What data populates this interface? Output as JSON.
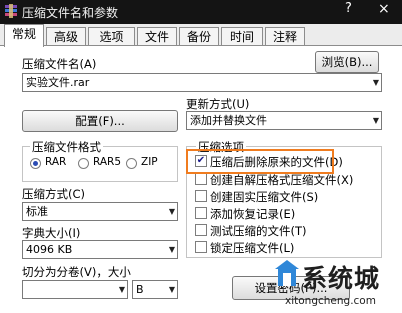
{
  "window": {
    "title": "压缩文件名和参数",
    "help": "?",
    "close": "×"
  },
  "tabs": [
    "常规",
    "高级",
    "选项",
    "文件",
    "备份",
    "时间",
    "注释"
  ],
  "archive_name": {
    "label": "压缩文件名(A)",
    "value": "实验文件.rar",
    "browse": "浏览(B)..."
  },
  "update_mode": {
    "label": "更新方式(U)",
    "value": "添加并替换文件"
  },
  "profile_button": "配置(F)...",
  "format": {
    "title": "压缩文件格式",
    "options": [
      "RAR",
      "RAR5",
      "ZIP"
    ],
    "selected": "RAR"
  },
  "method": {
    "label": "压缩方式(C)",
    "value": "标准"
  },
  "dict": {
    "label": "字典大小(I)",
    "value": "4096 KB"
  },
  "split": {
    "label": "切分为分卷(V)，大小",
    "value": "",
    "unit": "B"
  },
  "options": {
    "title": "压缩选项",
    "items": [
      {
        "label": "压缩后删除原来的文件(D)",
        "checked": true
      },
      {
        "label": "创建自解压格式压缩文件(X)",
        "checked": false
      },
      {
        "label": "创建固实压缩文件(S)",
        "checked": false
      },
      {
        "label": "添加恢复记录(E)",
        "checked": false
      },
      {
        "label": "测试压缩的文件(T)",
        "checked": false
      },
      {
        "label": "锁定压缩文件(L)",
        "checked": false
      }
    ]
  },
  "password_button": "设置密码(P)...",
  "watermark": {
    "text": "系统城",
    "url": "xitongcheng.com"
  },
  "accent": {
    "highlight": "#f07c1f",
    "check": "#1b1b8a",
    "radio": "#2a4bb3"
  }
}
